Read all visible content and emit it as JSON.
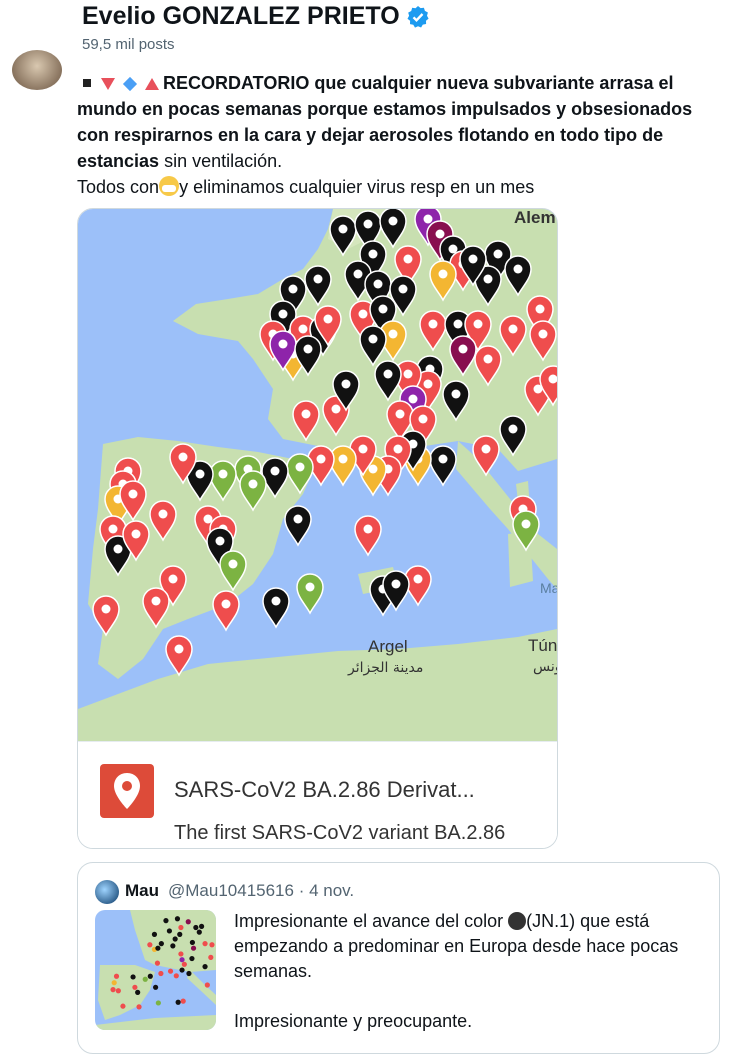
{
  "header": {
    "name": "Evelio GONZALEZ PRIETO",
    "posts": "59,5 mil posts"
  },
  "tweet": {
    "bold_text": "RECORDATORIO que cualquier nueva subvariante arrasa el mundo en pocas semanas porque estamos impulsados y obsesionados con respirarnos en la cara y dejar aerosoles flotando en todo tipo de estancias",
    "tail_text": " sin ventilación.",
    "line2_a": "Todos con",
    "line2_b": "y eliminamos cualquier virus resp en un mes"
  },
  "card": {
    "title": "SARS-CoV2 BA.2.86 Derivat...",
    "subtitle": "The first SARS-CoV2 variant BA.2.86",
    "map_labels": {
      "alem": "Alem",
      "argel": "Argel",
      "argel_ar": "مدينة الجزائر",
      "tun": "Tún",
      "tun_ar": "تونس",
      "ma": "Ma"
    }
  },
  "quote": {
    "name": "Mau",
    "handle": "@Mau10415616 · 4 nov.",
    "text_a": "Impresionante el avance del color ",
    "text_b": "(JN.1) que está empezando a predominar en Europa desde hace pocas semanas.",
    "text_c": "Impresionante y preocupante."
  },
  "colors": {
    "verified": "#1d9bf0",
    "pin_red": "#ef4d4d",
    "pin_black": "#111111",
    "pin_yellow": "#f3b632",
    "pin_green": "#7cb342",
    "pin_purple": "#8e24aa",
    "pin_maroon": "#880e4f",
    "sea": "#9cc0f9",
    "land": "#c8dfb0"
  }
}
